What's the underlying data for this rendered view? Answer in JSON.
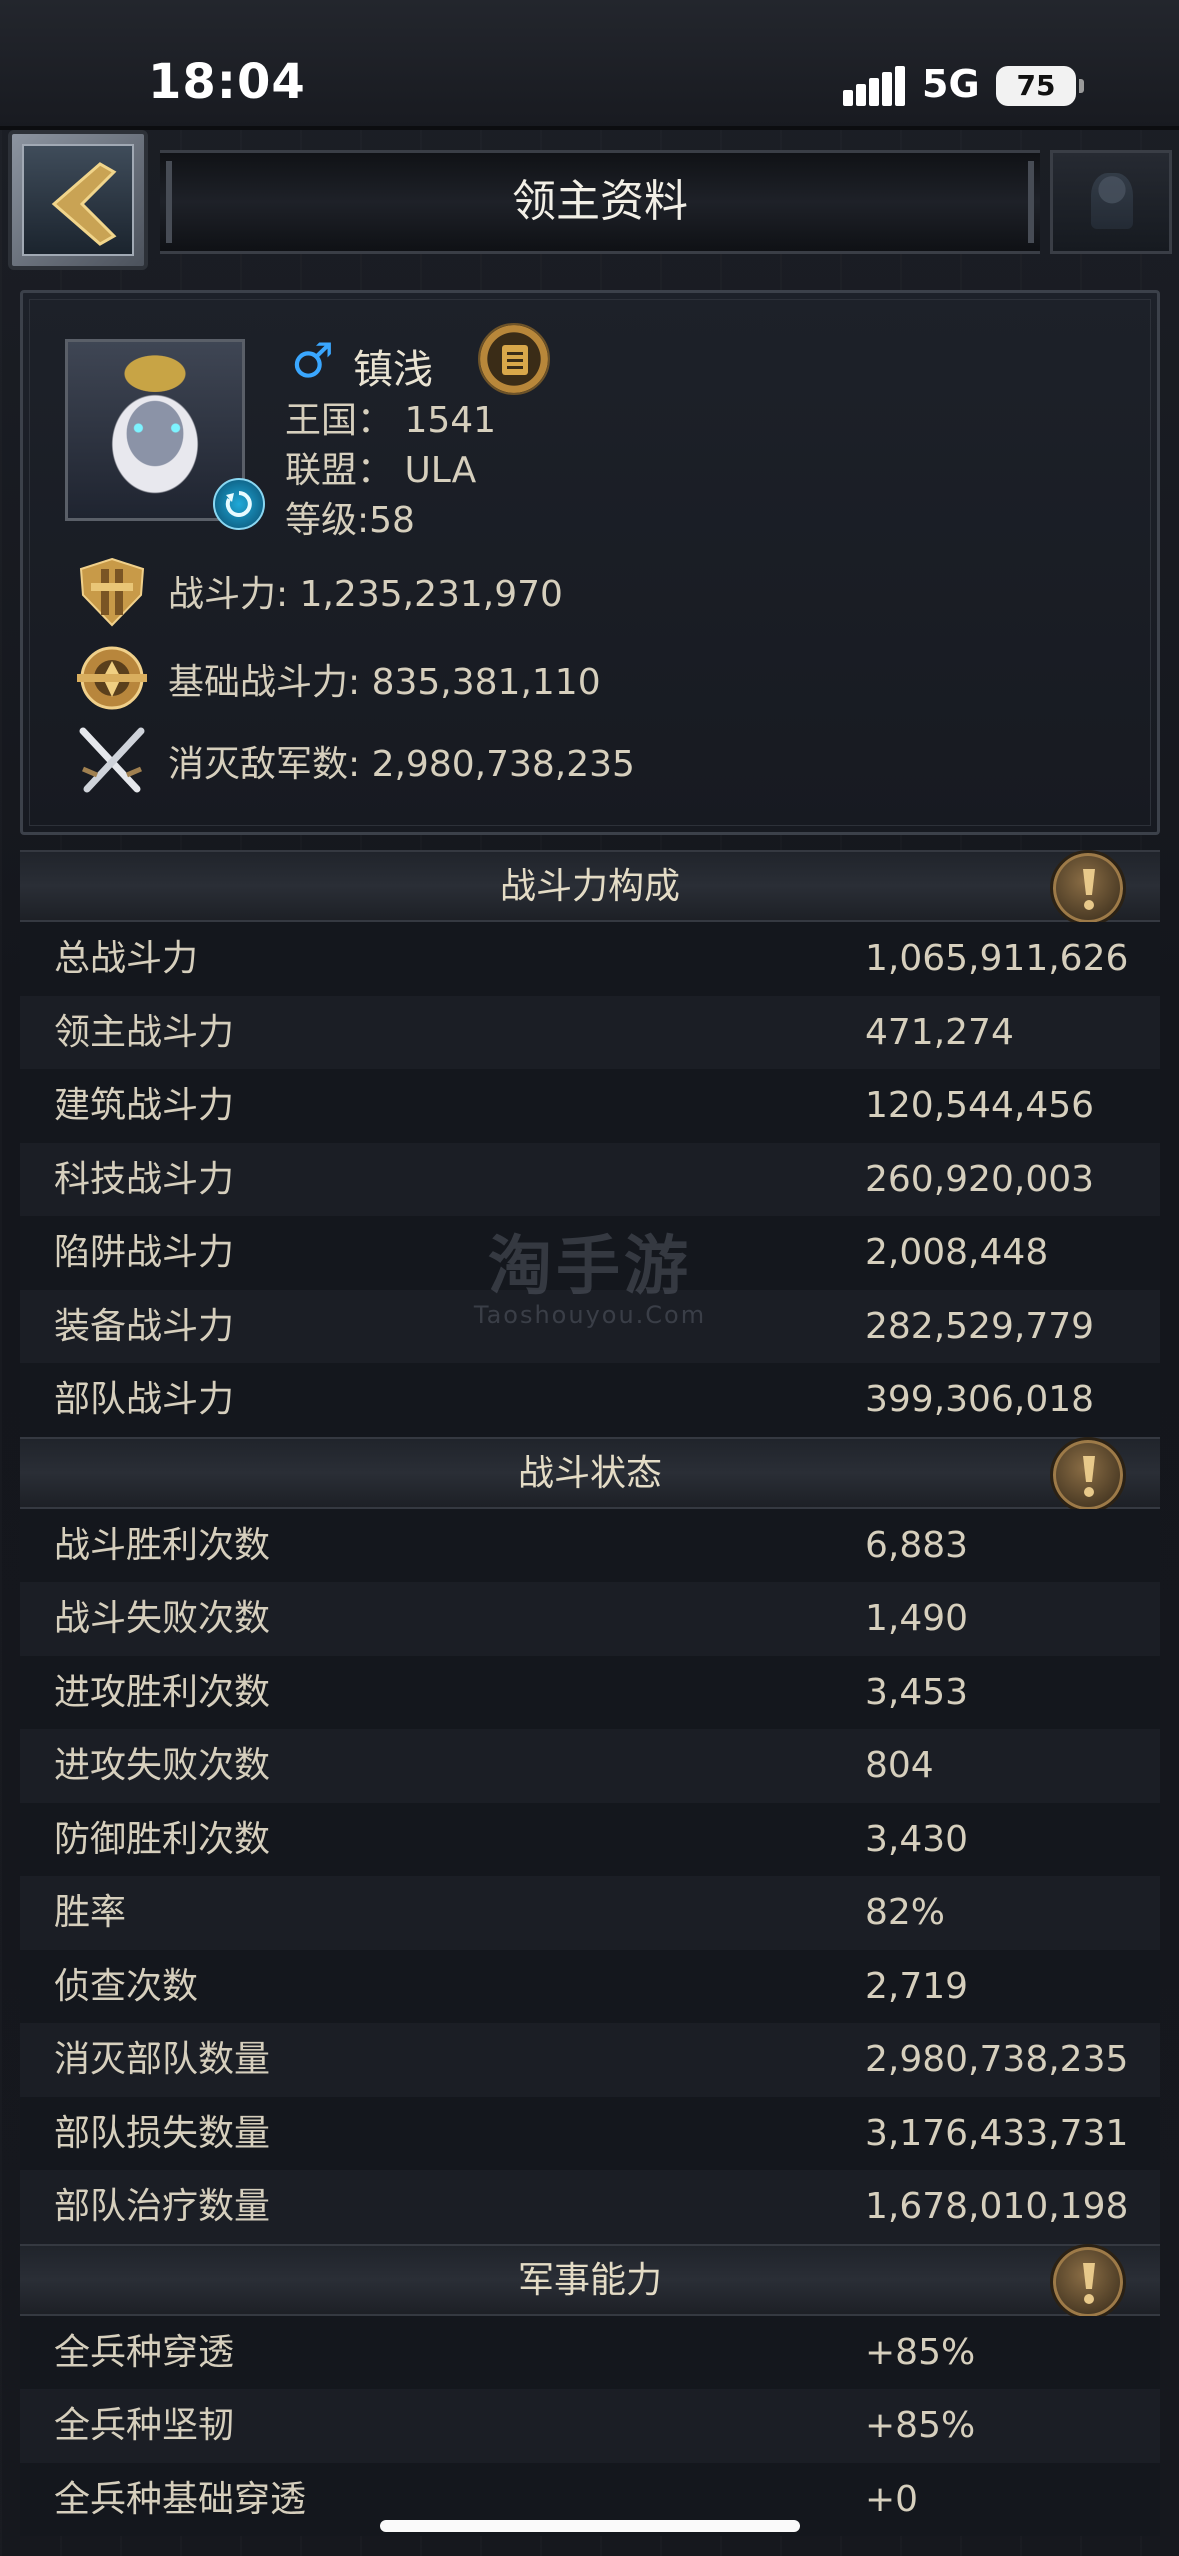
{
  "status_bar": {
    "time": "18:04",
    "network": "5G",
    "battery": "75"
  },
  "header": {
    "title": "领主资料"
  },
  "profile": {
    "gender_symbol": "♂",
    "name": "镇浅",
    "kingdom": "王国：  1541",
    "alliance": "联盟：  ULA",
    "level": "等级:58",
    "power": "战斗力: 1,235,231,970",
    "base_power": "基础战斗力: 835,381,110",
    "enemies_destroyed": "消灭敌军数: 2,980,738,235"
  },
  "sections": {
    "power_breakdown": {
      "title": "战斗力构成",
      "rows": [
        {
          "label": "总战斗力",
          "value": "1,065,911,626"
        },
        {
          "label": "领主战斗力",
          "value": "471,274"
        },
        {
          "label": "建筑战斗力",
          "value": "120,544,456"
        },
        {
          "label": "科技战斗力",
          "value": "260,920,003"
        },
        {
          "label": "陷阱战斗力",
          "value": "2,008,448"
        },
        {
          "label": "装备战斗力",
          "value": "282,529,779"
        },
        {
          "label": "部队战斗力",
          "value": "399,306,018"
        }
      ]
    },
    "battle_status": {
      "title": "战斗状态",
      "rows": [
        {
          "label": "战斗胜利次数",
          "value": "6,883"
        },
        {
          "label": "战斗失败次数",
          "value": "1,490"
        },
        {
          "label": "进攻胜利次数",
          "value": "3,453"
        },
        {
          "label": "进攻失败次数",
          "value": "804"
        },
        {
          "label": "防御胜利次数",
          "value": "3,430"
        },
        {
          "label": "胜率",
          "value": "82%"
        },
        {
          "label": "侦查次数",
          "value": "2,719"
        },
        {
          "label": "消灭部队数量",
          "value": "2,980,738,235"
        },
        {
          "label": "部队损失数量",
          "value": "3,176,433,731"
        },
        {
          "label": "部队治疗数量",
          "value": "1,678,010,198"
        }
      ]
    },
    "military": {
      "title": "军事能力",
      "rows": [
        {
          "label": "全兵种穿透",
          "value": "+85%"
        },
        {
          "label": "全兵种坚韧",
          "value": "+85%"
        },
        {
          "label": "全兵种基础穿透",
          "value": "+0"
        }
      ]
    }
  },
  "watermark": {
    "main": "淘手游",
    "sub": "Taoshouyou.Com"
  },
  "icons": {
    "back": "chevron-left-icon",
    "refresh": "refresh-icon",
    "gender": "male-icon",
    "document": "document-icon",
    "power": "power-emblem-icon",
    "base_power": "shield-emblem-icon",
    "kills": "crossed-swords-icon",
    "info": "info-icon"
  },
  "colors": {
    "accent_gold": "#b8873a",
    "male_blue": "#3aa7ff",
    "text": "#d6cfbd"
  }
}
